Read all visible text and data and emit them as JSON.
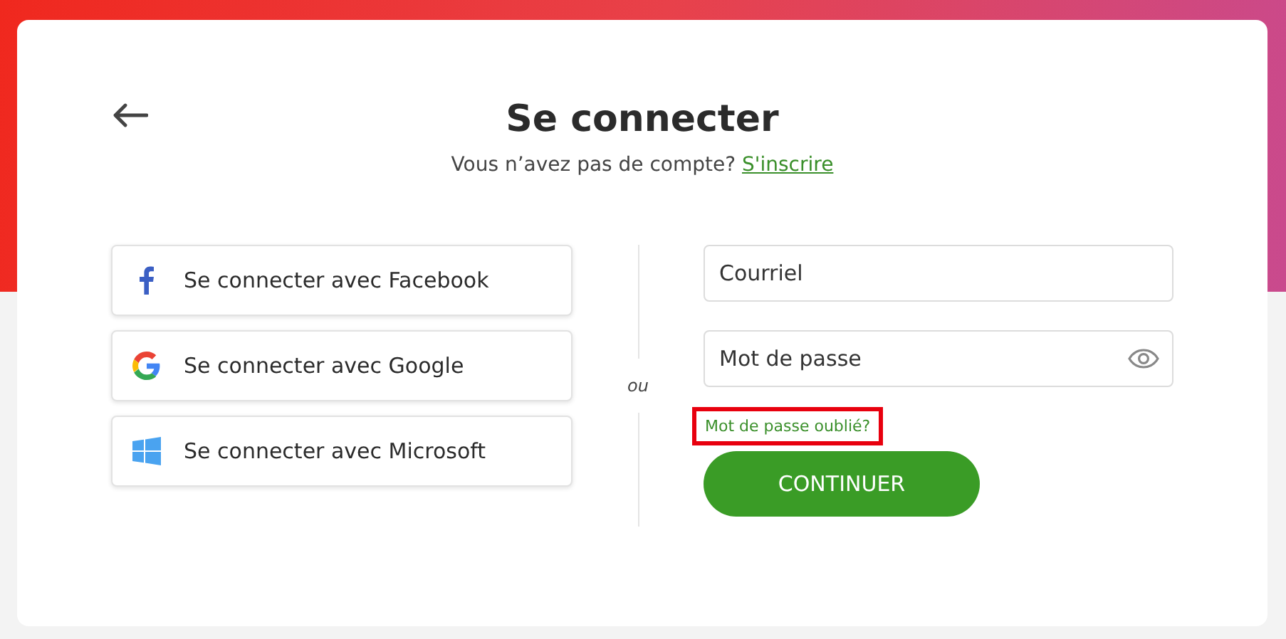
{
  "title": "Se connecter",
  "signup_prompt": {
    "text": "Vous n’avez pas de compte?",
    "link": "S'inscrire"
  },
  "social_buttons": [
    {
      "kind": "facebook",
      "label": "Se connecter avec Facebook"
    },
    {
      "kind": "google",
      "label": "Se connecter avec Google"
    },
    {
      "kind": "microsoft",
      "label": "Se connecter avec Microsoft"
    }
  ],
  "separator": "ou",
  "fields": [
    {
      "kind": "email",
      "placeholder": "Courriel"
    },
    {
      "kind": "password",
      "placeholder": "Mot de passe"
    }
  ],
  "forgot_link": {
    "label": "Mot de passe oublié?",
    "highlighted": true
  },
  "submit": "CONTINUER"
}
